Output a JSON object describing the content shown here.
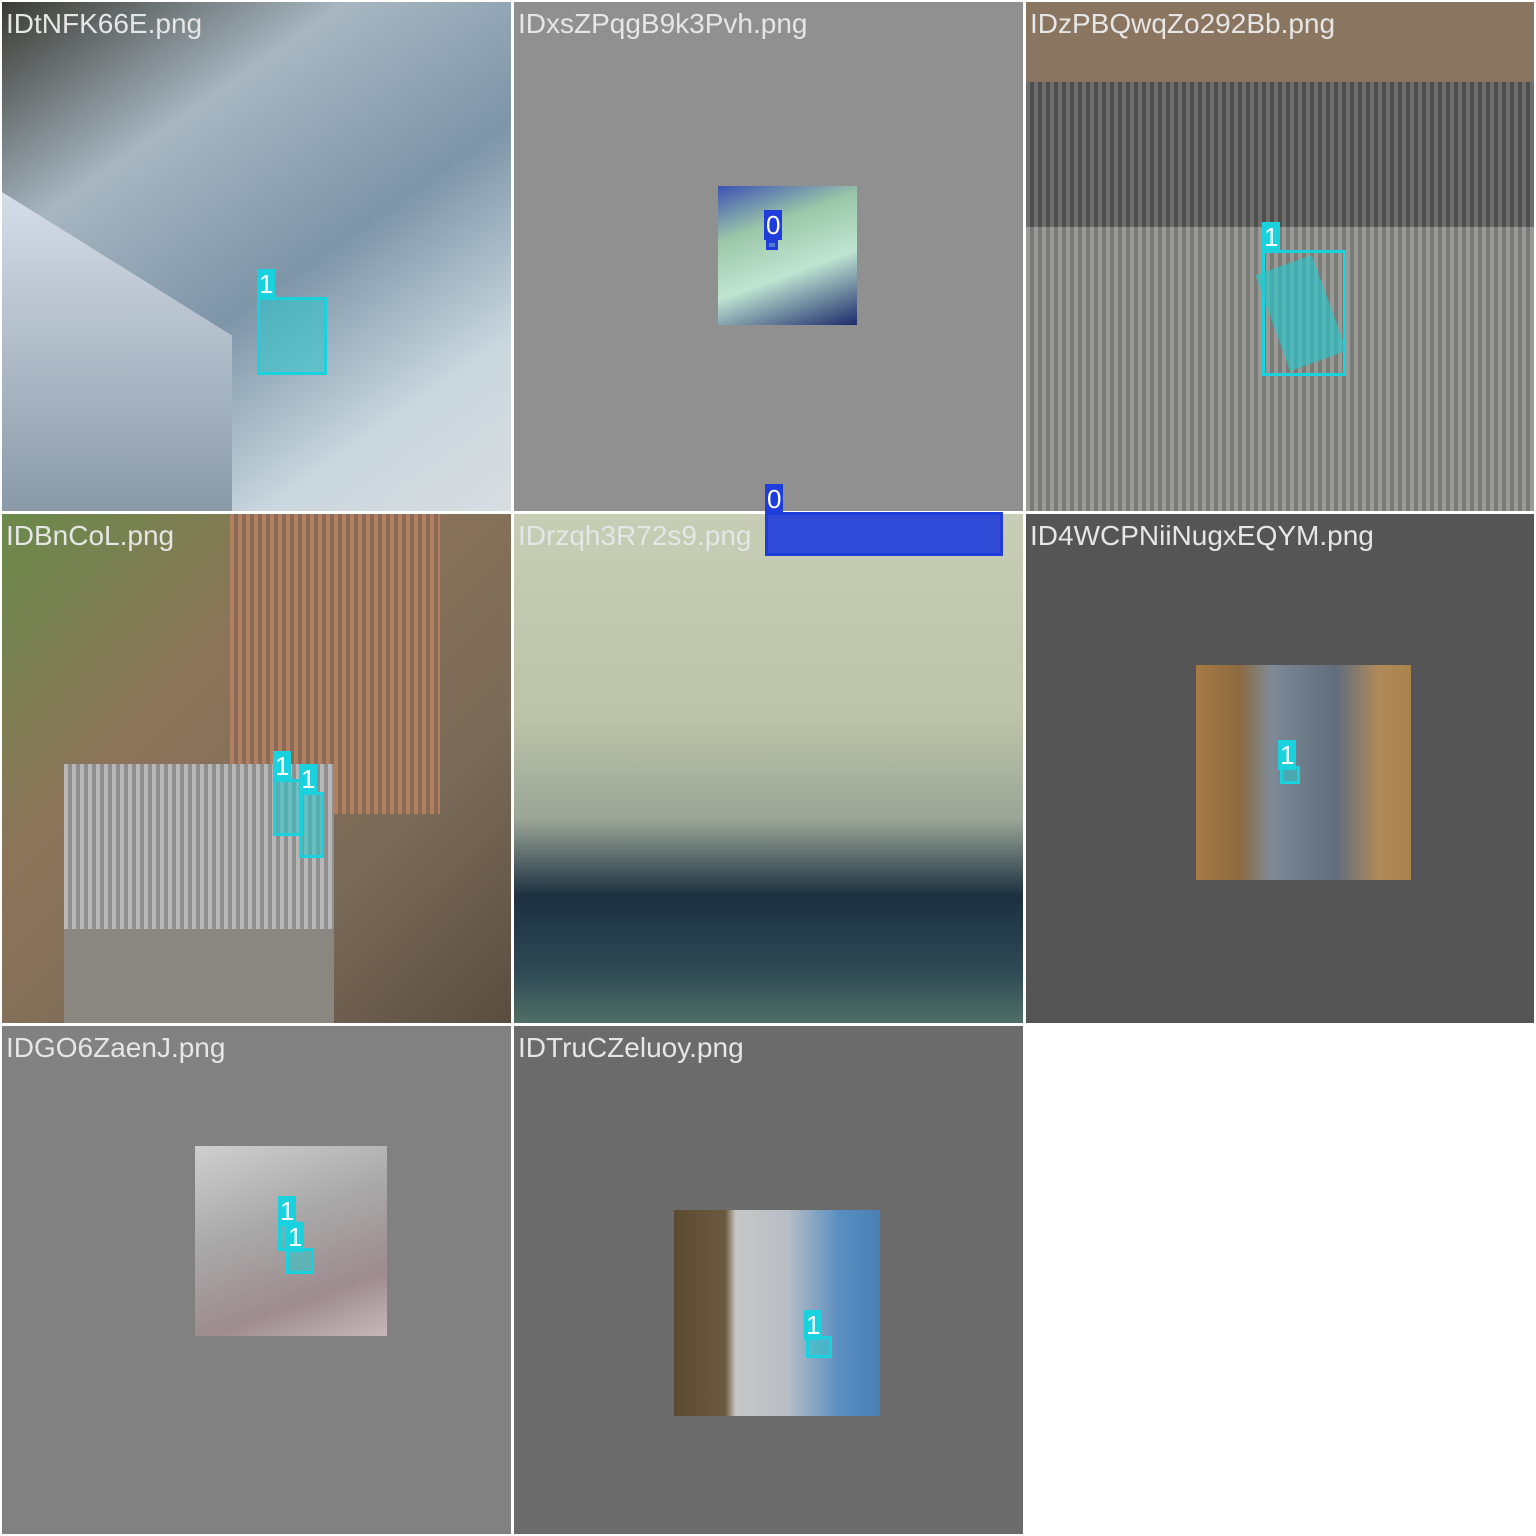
{
  "tiles": [
    {
      "name": "IDtNFK66E.png",
      "labels": [
        "1"
      ]
    },
    {
      "name": "IDxsZPqgB9k3Pvh.png",
      "labels": [
        "0"
      ]
    },
    {
      "name": "IDzPBQwqZo292Bb.png",
      "labels": [
        "1"
      ]
    },
    {
      "name": "IDBnCoL.png",
      "labels": [
        "1",
        "1"
      ]
    },
    {
      "name": "IDrzqh3R72s9.png",
      "labels": [
        "0"
      ]
    },
    {
      "name": "ID4WCPNiiNugxEQYM.png",
      "labels": [
        "1"
      ]
    },
    {
      "name": "IDGO6ZaenJ.png",
      "labels": [
        "1",
        "1"
      ]
    },
    {
      "name": "IDTruCZeluoy.png",
      "labels": [
        "1"
      ]
    }
  ],
  "colors": {
    "class_1": "#19d2de",
    "class_0": "#1f3ddb"
  }
}
